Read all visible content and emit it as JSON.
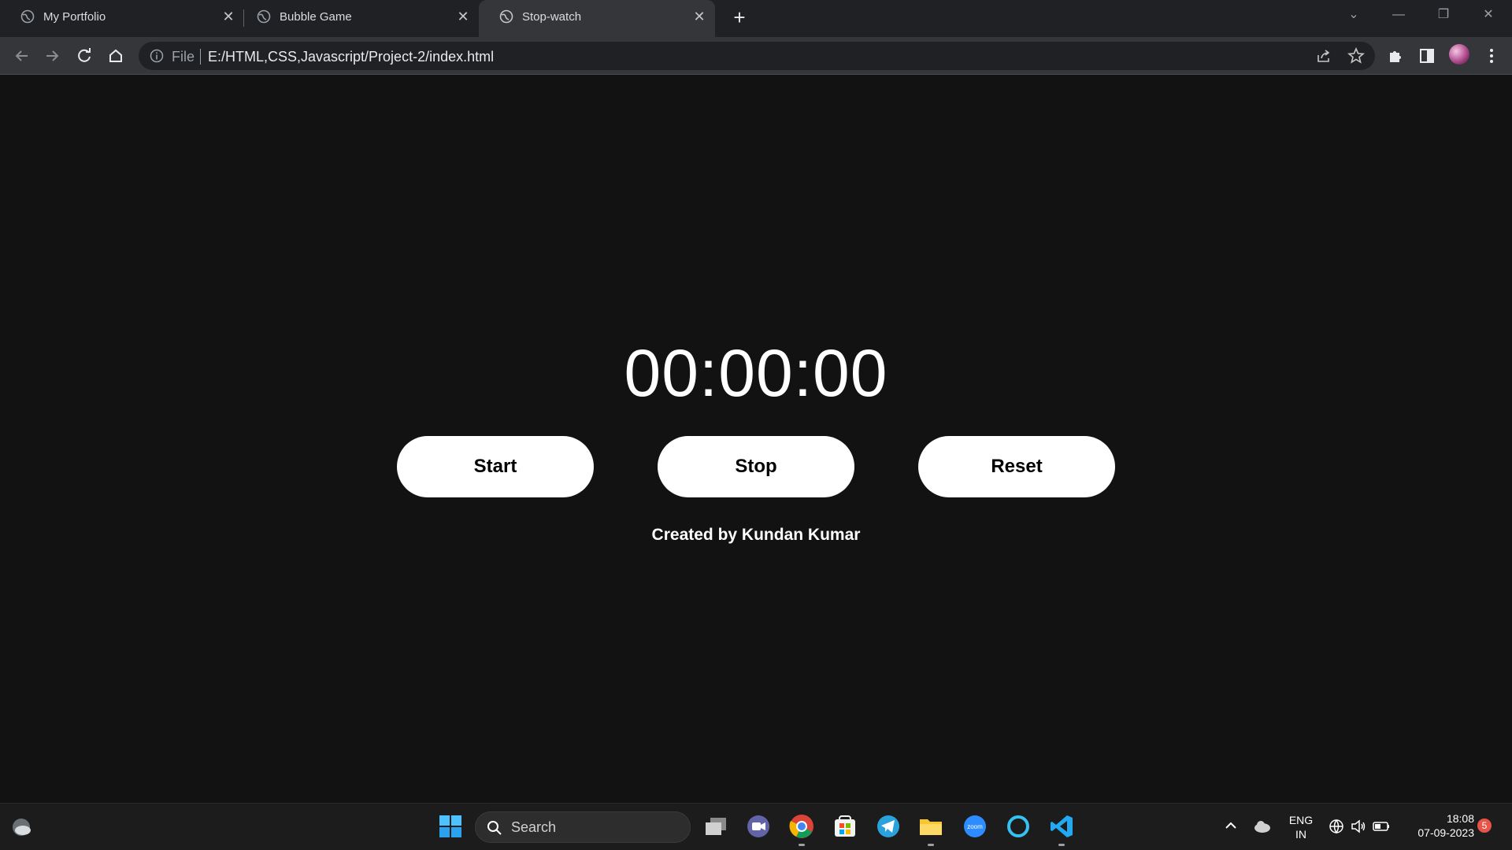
{
  "browser": {
    "tabs": [
      {
        "title": "My Portfolio",
        "active": false
      },
      {
        "title": "Bubble Game",
        "active": false
      },
      {
        "title": "Stop-watch",
        "active": true
      }
    ],
    "new_tab_icon": "plus-icon",
    "address_bar": {
      "scheme_label": "File",
      "url": "E:/HTML,CSS,Javascript/Project-2/index.html"
    }
  },
  "page": {
    "timer": "00:00:00",
    "buttons": {
      "start": "Start",
      "stop": "Stop",
      "reset": "Reset"
    },
    "credit": "Created by Kundan Kumar"
  },
  "taskbar": {
    "search_label": "Search",
    "language": {
      "line1": "ENG",
      "line2": "IN"
    },
    "clock": {
      "time": "18:08",
      "date": "07-09-2023"
    },
    "notification_count": "5",
    "pinned_apps": [
      "start-menu",
      "task-view",
      "teams",
      "chrome",
      "microsoft-store",
      "telegram",
      "file-explorer",
      "zoom",
      "cortana",
      "vscode"
    ]
  },
  "colors": {
    "page_background": "#121212",
    "button_background": "#ffffff",
    "chrome_toolbar": "#35363a",
    "chrome_tabstrip": "#202124"
  }
}
